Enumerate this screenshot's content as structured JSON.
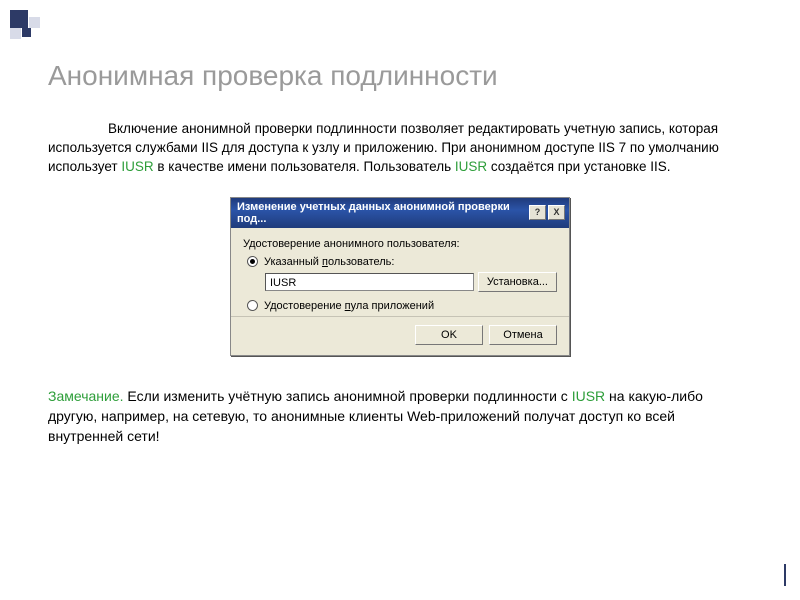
{
  "title": "Анонимная проверка подлинности",
  "paragraph": {
    "t1": "Включение анонимной проверки подлинности позволяет редактировать учетную запись, которая используется службами IIS для доступа к узлу и приложению. При анонимном доступе IIS 7 по умолчанию использует ",
    "iusr1": "IUSR",
    "t2": " в качестве имени пользователя. Пользователь ",
    "iusr2": "IUSR",
    "t3": " создаётся при установке IIS."
  },
  "dialog": {
    "title": "Изменение учетных данных анонимной проверки под...",
    "help_btn": "?",
    "close_btn": "X",
    "label": "Удостоверение анонимного пользователя:",
    "radio1_pre": "Указанный ",
    "radio1_u": "п",
    "radio1_post": "ользователь:",
    "user_value": "IUSR",
    "set_button": "Установка...",
    "radio2_pre": "Удостоверение ",
    "radio2_u": "п",
    "radio2_post": "ула приложений",
    "ok": "OK",
    "cancel": "Отмена"
  },
  "note": {
    "label": "Замечание.",
    "t1": "  Если изменить учётную запись анонимной проверки подлинности с ",
    "iusr": "IUSR",
    "t2": " на какую-либо другую, например, на сетевую, то анонимные клиенты Web-приложений получат доступ ко всей внутренней сети!"
  }
}
